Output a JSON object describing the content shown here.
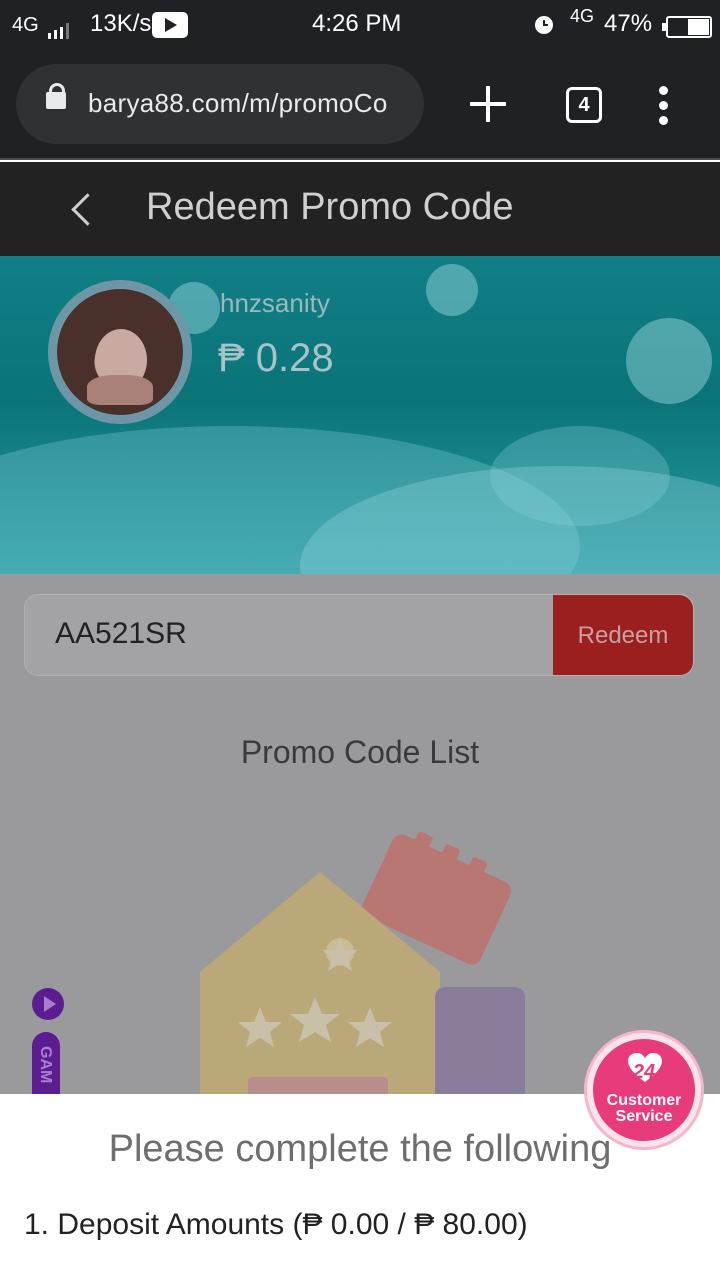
{
  "status_bar": {
    "network": "4G",
    "speed": "13K/s",
    "time": "4:26 PM",
    "network_right": "4G",
    "battery": "47%"
  },
  "browser": {
    "url": "barya88.com/m/promoCo",
    "tab_count": "4"
  },
  "header": {
    "title": "Redeem Promo Code"
  },
  "profile": {
    "username": "hnzsanity",
    "balance": "₱ 0.28"
  },
  "promo": {
    "code_value": "AA521SR",
    "redeem_label": "Redeem",
    "list_title": "Promo Code List"
  },
  "side_tab": {
    "label": "GAM"
  },
  "sheet": {
    "title": "Please complete the following",
    "item_1": "1. Deposit Amounts (₱ 0.00 / ₱ 80.00)"
  },
  "customer_service": {
    "badge": "24",
    "label": "Customer Service"
  },
  "colors": {
    "header_bg": "#222222",
    "banner_teal": "#0a7478",
    "redeem_red": "#9b1f1f",
    "cs_pink": "#e73b7c"
  }
}
